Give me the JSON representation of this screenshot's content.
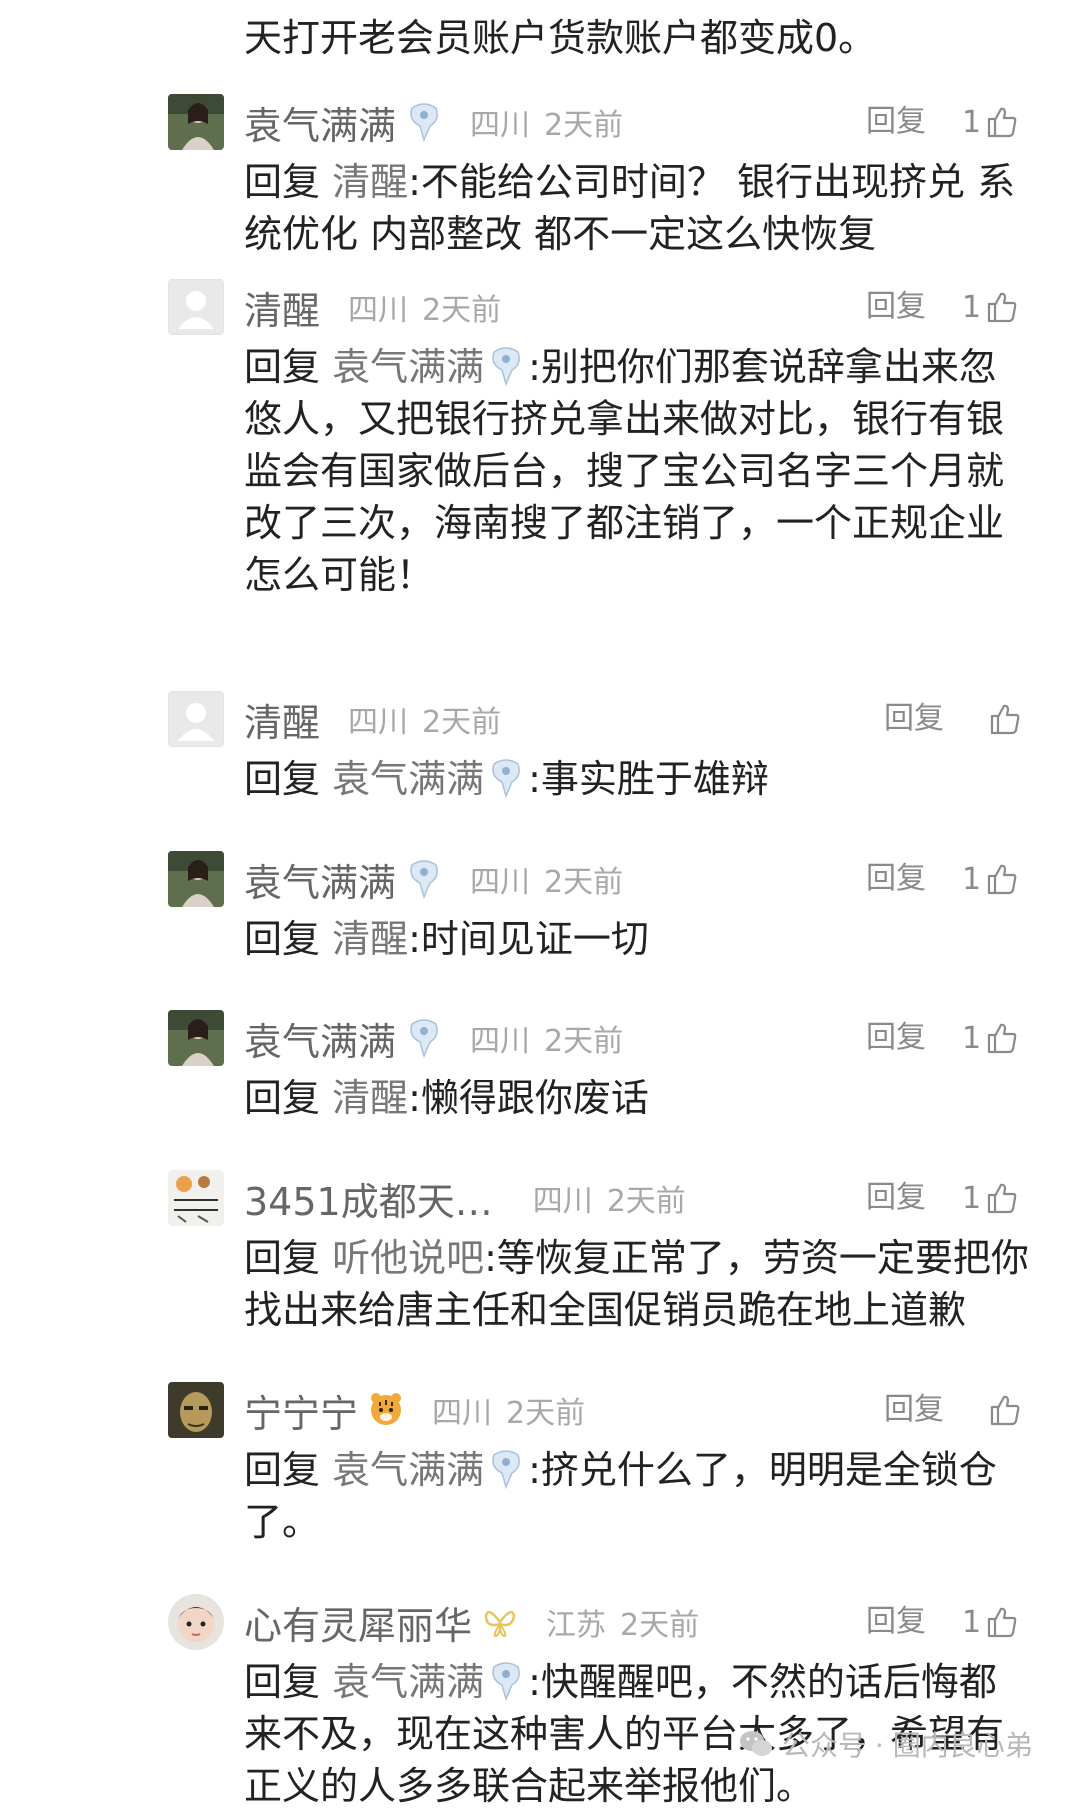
{
  "top_text": "天打开老会员账户货款账户都变成0。",
  "reply_label": "回复",
  "comments": [
    {
      "name": "袁气满满",
      "location": "四川",
      "time": "2天前",
      "likes": "1",
      "avatar": "woman-photo-avatar",
      "badge": "blue-fan-badge",
      "reply_prefix": "回复",
      "reply_to": "清醒",
      "reply_to_badge": "",
      "content": ":不能给公司时间？ 银行出现挤兑 系统优化 内部整改 都不一定这么快恢复"
    },
    {
      "name": "清醒",
      "location": "四川",
      "time": "2天前",
      "likes": "1",
      "avatar": "default-user-avatar",
      "badge": "",
      "reply_prefix": "回复",
      "reply_to": "袁气满满",
      "reply_to_badge": "blue-fan-badge",
      "content": ":别把你们那套说辞拿出来忽悠人，又把银行挤兑拿出来做对比，银行有银监会有国家做后台，搜了宝公司名字三个月就改了三次，海南搜了都注销了，一个正规企业怎么可能！"
    },
    {
      "name": "清醒",
      "location": "四川",
      "time": "2天前",
      "likes": "",
      "avatar": "default-user-avatar",
      "badge": "",
      "reply_prefix": "回复",
      "reply_to": "袁气满满",
      "reply_to_badge": "blue-fan-badge",
      "content": ":事实胜于雄辩"
    },
    {
      "name": "袁气满满",
      "location": "四川",
      "time": "2天前",
      "likes": "1",
      "avatar": "woman-photo-avatar",
      "badge": "blue-fan-badge",
      "reply_prefix": "回复",
      "reply_to": "清醒",
      "reply_to_badge": "",
      "content": ":时间见证一切"
    },
    {
      "name": "袁气满满",
      "location": "四川",
      "time": "2天前",
      "likes": "1",
      "avatar": "woman-photo-avatar",
      "badge": "blue-fan-badge",
      "reply_prefix": "回复",
      "reply_to": "清醒",
      "reply_to_badge": "",
      "content": ":懒得跟你废话"
    },
    {
      "name": "3451成都天…",
      "location": "四川",
      "time": "2天前",
      "likes": "1",
      "avatar": "text-sticker-avatar",
      "badge": "",
      "reply_prefix": "回复",
      "reply_to": "听他说吧",
      "reply_to_badge": "",
      "content": ":等恢复正常了，劳资一定要把你找出来给唐主任和全国促销员跪在地上道歉"
    },
    {
      "name": "宁宁宁",
      "location": "四川",
      "time": "2天前",
      "likes": "",
      "avatar": "man-face-avatar",
      "badge": "tiger-badge",
      "reply_prefix": "回复",
      "reply_to": "袁气满满",
      "reply_to_badge": "blue-fan-badge",
      "content": ":挤兑什么了，明明是全锁仓了。"
    },
    {
      "name": "心有灵犀丽华",
      "location": "江苏",
      "time": "2天前",
      "likes": "1",
      "avatar": "child-photo-avatar",
      "badge": "gold-butterfly-badge",
      "reply_prefix": "回复",
      "reply_to": "袁气满满",
      "reply_to_badge": "blue-fan-badge",
      "content": ":快醒醒吧，不然的话后悔都来不及，现在这种害人的平台太多了，希望有正义的人多多联合起来举报他们。"
    }
  ],
  "watermark": {
    "icon": "wechat-icon",
    "text": "公众号 · 圈内良心弟"
  },
  "colors": {
    "name": "#666666",
    "meta": "#a8a8a8",
    "body": "#222222",
    "reply_target": "#777777"
  }
}
